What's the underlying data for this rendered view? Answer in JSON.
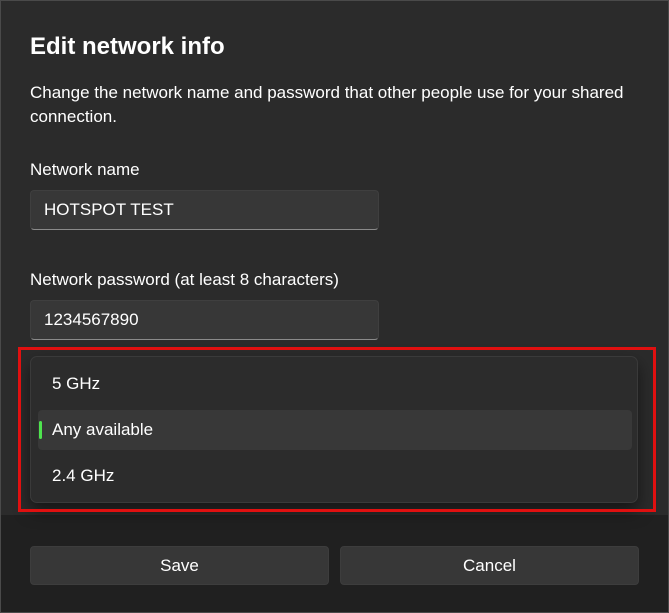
{
  "dialog": {
    "title": "Edit network info",
    "description": "Change the network name and password that other people use for your shared connection."
  },
  "network_name": {
    "label": "Network name",
    "value": "HOTSPOT TEST"
  },
  "network_password": {
    "label": "Network password (at least 8 characters)",
    "value": "1234567890"
  },
  "band_dropdown": {
    "options": [
      "5 GHz",
      "Any available",
      "2.4 GHz"
    ],
    "selected": "Any available",
    "indicator_color": "#4ee34e"
  },
  "footer": {
    "save_label": "Save",
    "cancel_label": "Cancel"
  },
  "annotation": {
    "highlight_color": "#e01010"
  }
}
